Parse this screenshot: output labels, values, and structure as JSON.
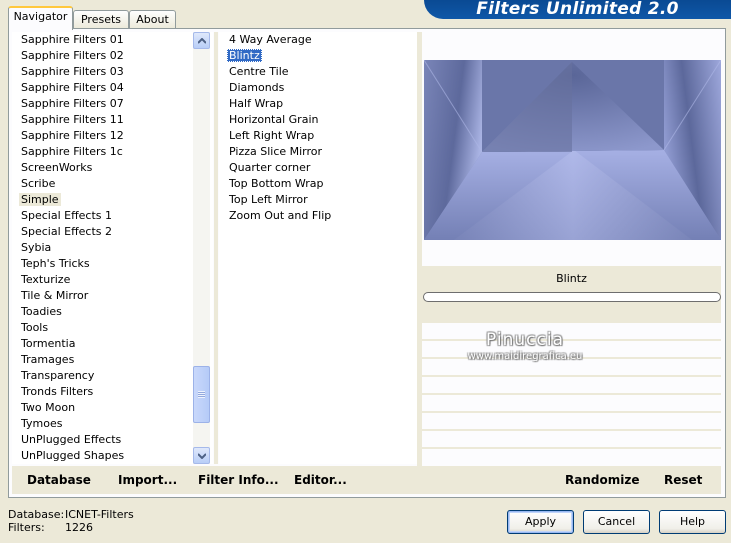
{
  "banner": {
    "title": "Filters Unlimited 2.0"
  },
  "tabs": [
    {
      "label": "Navigator",
      "active": true
    },
    {
      "label": "Presets",
      "active": false
    },
    {
      "label": "About",
      "active": false
    }
  ],
  "categories": {
    "items": [
      "Sapphire Filters 01",
      "Sapphire Filters 02",
      "Sapphire Filters 03",
      "Sapphire Filters 04",
      "Sapphire Filters 07",
      "Sapphire Filters 11",
      "Sapphire Filters 12",
      "Sapphire Filters 1c",
      "ScreenWorks",
      "Scribe",
      "Simple",
      "Special Effects 1",
      "Special Effects 2",
      "Sybia",
      "Teph's Tricks",
      "Texturize",
      "Tile & Mirror",
      "Toadies",
      "Tools",
      "Tormentia",
      "Tramages",
      "Transparency",
      "Tronds Filters",
      "Two Moon",
      "Tymoes",
      "UnPlugged Effects",
      "UnPlugged Shapes"
    ],
    "selected": "Simple"
  },
  "filters": {
    "items": [
      "4 Way Average",
      "Blintz",
      "Centre Tile",
      "Diamonds",
      "Half Wrap",
      "Horizontal Grain",
      "Left Right Wrap",
      "Pizza Slice Mirror",
      "Quarter corner",
      "Top Bottom Wrap",
      "Top Left Mirror",
      "Zoom Out and Flip"
    ],
    "selected": "Blintz"
  },
  "preview": {
    "filter_name": "Blintz"
  },
  "watermark": {
    "name": "Pinuccia",
    "url": "www.maidiregrafica.eu"
  },
  "commands": {
    "database": "Database",
    "import": "Import...",
    "filter_info": "Filter Info...",
    "editor": "Editor...",
    "randomize": "Randomize",
    "reset": "Reset"
  },
  "footer": {
    "database_label": "Database:",
    "database_value": "ICNET-Filters",
    "filters_label": "Filters:",
    "filters_value": "1226"
  },
  "buttons": {
    "apply": "Apply",
    "cancel": "Cancel",
    "help": "Help"
  },
  "colors": {
    "banner": "#0f57a8",
    "selection": "#316ac5",
    "dialog_bg": "#ece9d8"
  }
}
